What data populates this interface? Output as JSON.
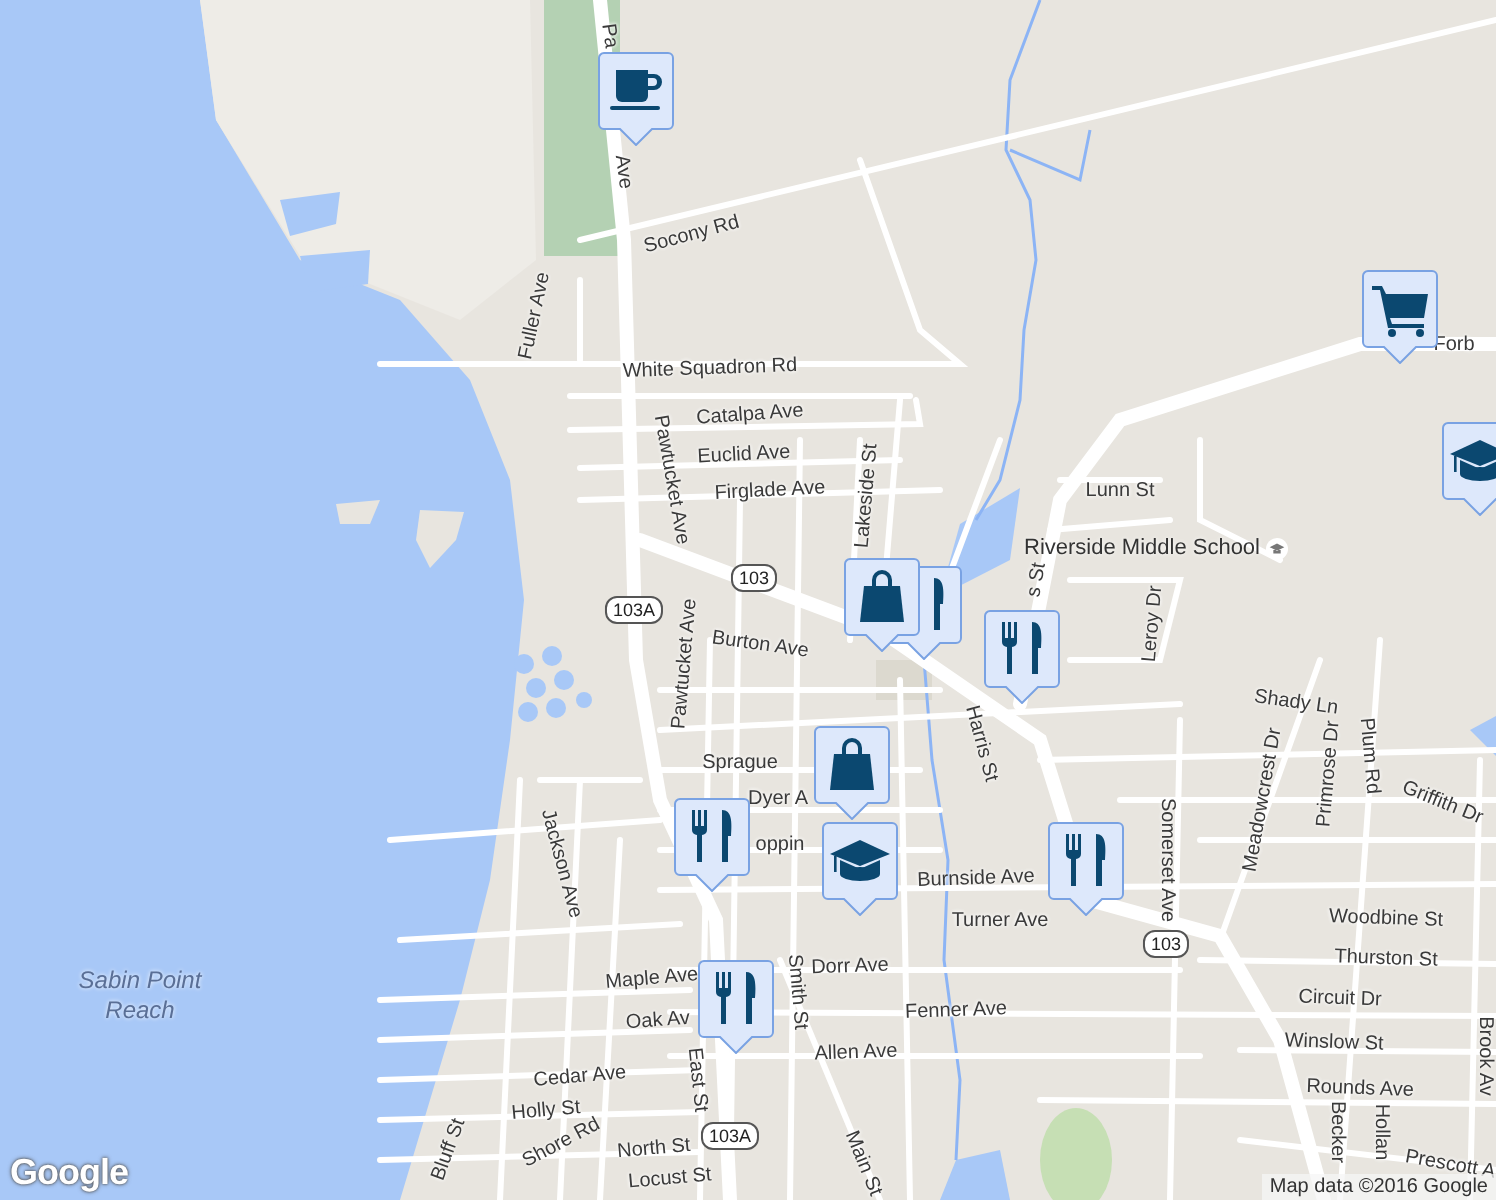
{
  "map": {
    "street_labels": [
      "Pa",
      "Ave",
      "Socony Rd",
      "Fuller Ave",
      "White Squadron Rd",
      "Catalpa Ave",
      "Euclid Ave",
      "Firglade Ave",
      "Pawtucket Ave",
      "Lakeside St",
      "Lunn St",
      "s St",
      "Leroy Dr",
      "Burton Ave",
      "Pawtucket Ave",
      "Harris St",
      "Sprague",
      "Dyer A",
      "oppin",
      "Burnside Ave",
      "Turner Ave",
      "Jackson Ave",
      "Maple Ave",
      "Dorr Ave",
      "Smith St",
      "Oak Av",
      "Fenner Ave",
      "Allen Ave",
      "East St",
      "Main St",
      "Cedar Ave",
      "Holly St",
      "Shore Rd",
      "North St",
      "Locust St",
      "Bluff St",
      "Forb",
      "Shady Ln",
      "Primrose Dr",
      "Plum Rd",
      "Griffith Dr",
      "Somerset Ave",
      "Meadowcrest Dr",
      "Woodbine St",
      "Thurston St",
      "Circuit Dr",
      "Winslow St",
      "Rounds Ave",
      "Becker",
      "Hollan",
      "Prescott A",
      "Brook Av"
    ],
    "poi_labels": [
      "Riverside Middle School"
    ],
    "water_labels": [
      "Sabin Point Reach"
    ],
    "route_shields": [
      "103",
      "103A",
      "103",
      "103A"
    ],
    "markers": [
      {
        "kind": "cafe"
      },
      {
        "kind": "cart"
      },
      {
        "kind": "school"
      },
      {
        "kind": "restaurant"
      },
      {
        "kind": "shopping"
      },
      {
        "kind": "restaurant"
      },
      {
        "kind": "shopping"
      },
      {
        "kind": "restaurant"
      },
      {
        "kind": "school"
      },
      {
        "kind": "restaurant"
      },
      {
        "kind": "restaurant"
      }
    ],
    "logo": "Google",
    "attribution": "Map data ©2016 Google"
  }
}
